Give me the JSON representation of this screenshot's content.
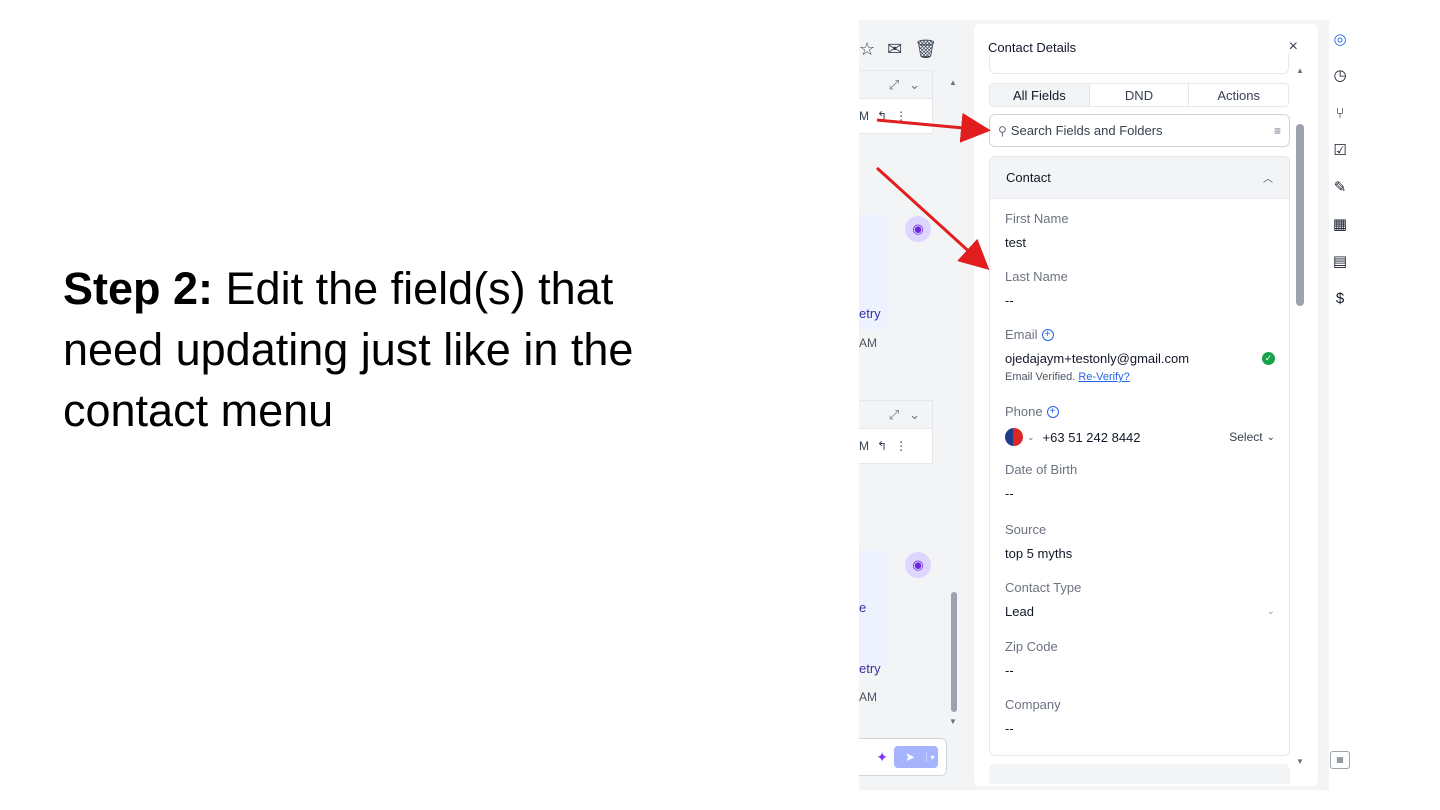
{
  "caption": {
    "step": "Step 2:",
    "text": " Edit the field(s) that need updating just like in the contact menu"
  },
  "conversation": {
    "card1_time": "M",
    "card2_time": "M",
    "retry1": "etry",
    "retry2": "etry",
    "partial_e": "e",
    "time1": "AM",
    "time2": "AM"
  },
  "panel": {
    "title": "Contact Details",
    "close": "×",
    "tabs": [
      "All Fields",
      "DND",
      "Actions"
    ],
    "search_placeholder": "Search Fields and Folders",
    "section_title": "Contact",
    "fields": {
      "first_name": {
        "label": "First Name",
        "value": "test"
      },
      "last_name": {
        "label": "Last Name",
        "value": "--"
      },
      "email": {
        "label": "Email",
        "value": "ojedajaym+testonly@gmail.com",
        "status": "Email Verified.",
        "reverify": "Re-Verify?"
      },
      "phone": {
        "label": "Phone",
        "value": "+63 51 242 8442",
        "select": "Select"
      },
      "dob": {
        "label": "Date of Birth",
        "value": "--"
      },
      "source": {
        "label": "Source",
        "value": "top 5 myths"
      },
      "contact_type": {
        "label": "Contact Type",
        "value": "Lead"
      },
      "zip": {
        "label": "Zip Code",
        "value": "--"
      },
      "company": {
        "label": "Company",
        "value": "--"
      }
    }
  },
  "rail_icons": [
    "contact-icon",
    "clock-icon",
    "workflow-icon",
    "task-icon",
    "pen-icon",
    "calendar-icon",
    "document-icon",
    "payment-icon",
    "keyboard-icon"
  ],
  "colors": {
    "accent": "#2563eb",
    "arrow": "#e11d1d",
    "verified": "#16a34a"
  }
}
